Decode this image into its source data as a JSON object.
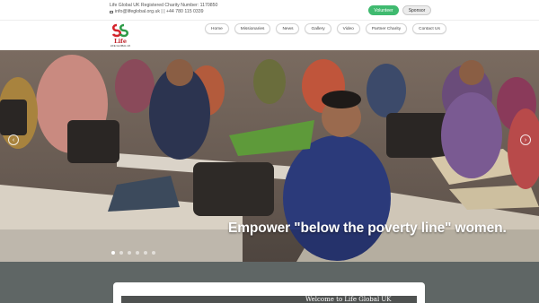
{
  "topbar": {
    "charity_line": "Life Global UK Registered Charity Number: 1170850",
    "contact_line": "info@lifeglobal.org.uk | | +44 780 115 0339",
    "volunteer_label": "Volunteer",
    "sponsor_label": "Sponsor",
    "icons": {
      "email": "envelope-icon"
    }
  },
  "header": {
    "logo_name": "Life",
    "logo_sub": "LIFE GLOBAL UK",
    "nav": [
      "Home",
      "Missionaries",
      "News",
      "Gallery",
      "Video",
      "Partner Charity",
      "Contact Us"
    ]
  },
  "hero": {
    "caption": "Empower \"below the poverty line\" women.",
    "slide_count": 6,
    "active_slide": 1,
    "icons": {
      "prev": "chevron-left-icon",
      "next": "chevron-right-icon"
    }
  },
  "welcome": {
    "title": "Welcome to Life Global UK"
  },
  "colors": {
    "volunteer_green": "#3fba6f",
    "logo_red": "#c0262d",
    "lower_bg": "#5f6665"
  }
}
